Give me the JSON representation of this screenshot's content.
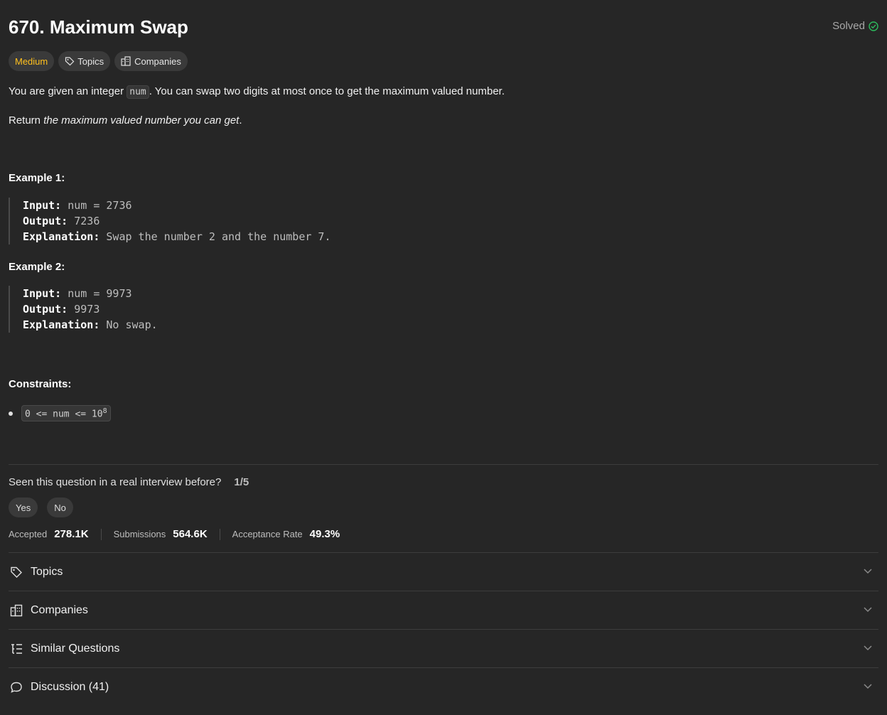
{
  "problem": {
    "title": "670. Maximum Swap",
    "status": "Solved",
    "difficulty": "Medium",
    "tags": {
      "topics": "Topics",
      "companies": "Companies"
    }
  },
  "description": {
    "line1_pre": "You are given an integer ",
    "line1_code": "num",
    "line1_post": ". You can swap two digits at most once to get the maximum valued number.",
    "line2_pre": "Return ",
    "line2_em": "the maximum valued number you can get",
    "line2_post": "."
  },
  "examples": [
    {
      "title": "Example 1:",
      "input_label": "Input:",
      "input": "num = 2736",
      "output_label": "Output:",
      "output": "7236",
      "explanation_label": "Explanation:",
      "explanation": "Swap the number 2 and the number 7."
    },
    {
      "title": "Example 2:",
      "input_label": "Input:",
      "input": "num = 9973",
      "output_label": "Output:",
      "output": "9973",
      "explanation_label": "Explanation:",
      "explanation": "No swap."
    }
  ],
  "constraints": {
    "title": "Constraints:",
    "item_base": "0 <= num <= 10",
    "item_exp": "8"
  },
  "interview": {
    "question": "Seen this question in a real interview before?",
    "rate": "1/5",
    "yes": "Yes",
    "no": "No"
  },
  "stats": {
    "accepted_label": "Accepted",
    "accepted": "278.1K",
    "submissions_label": "Submissions",
    "submissions": "564.6K",
    "rate_label": "Acceptance Rate",
    "rate": "49.3%"
  },
  "sections": [
    {
      "label": "Topics",
      "icon": "tag-icon"
    },
    {
      "label": "Companies",
      "icon": "building-icon"
    },
    {
      "label": "Similar Questions",
      "icon": "list-tree-icon"
    },
    {
      "label": "Discussion (41)",
      "icon": "chat-bubble-icon"
    }
  ],
  "colors": {
    "background": "#262626",
    "medium": "#ffc01e",
    "solved_check": "#2cbb5d"
  }
}
